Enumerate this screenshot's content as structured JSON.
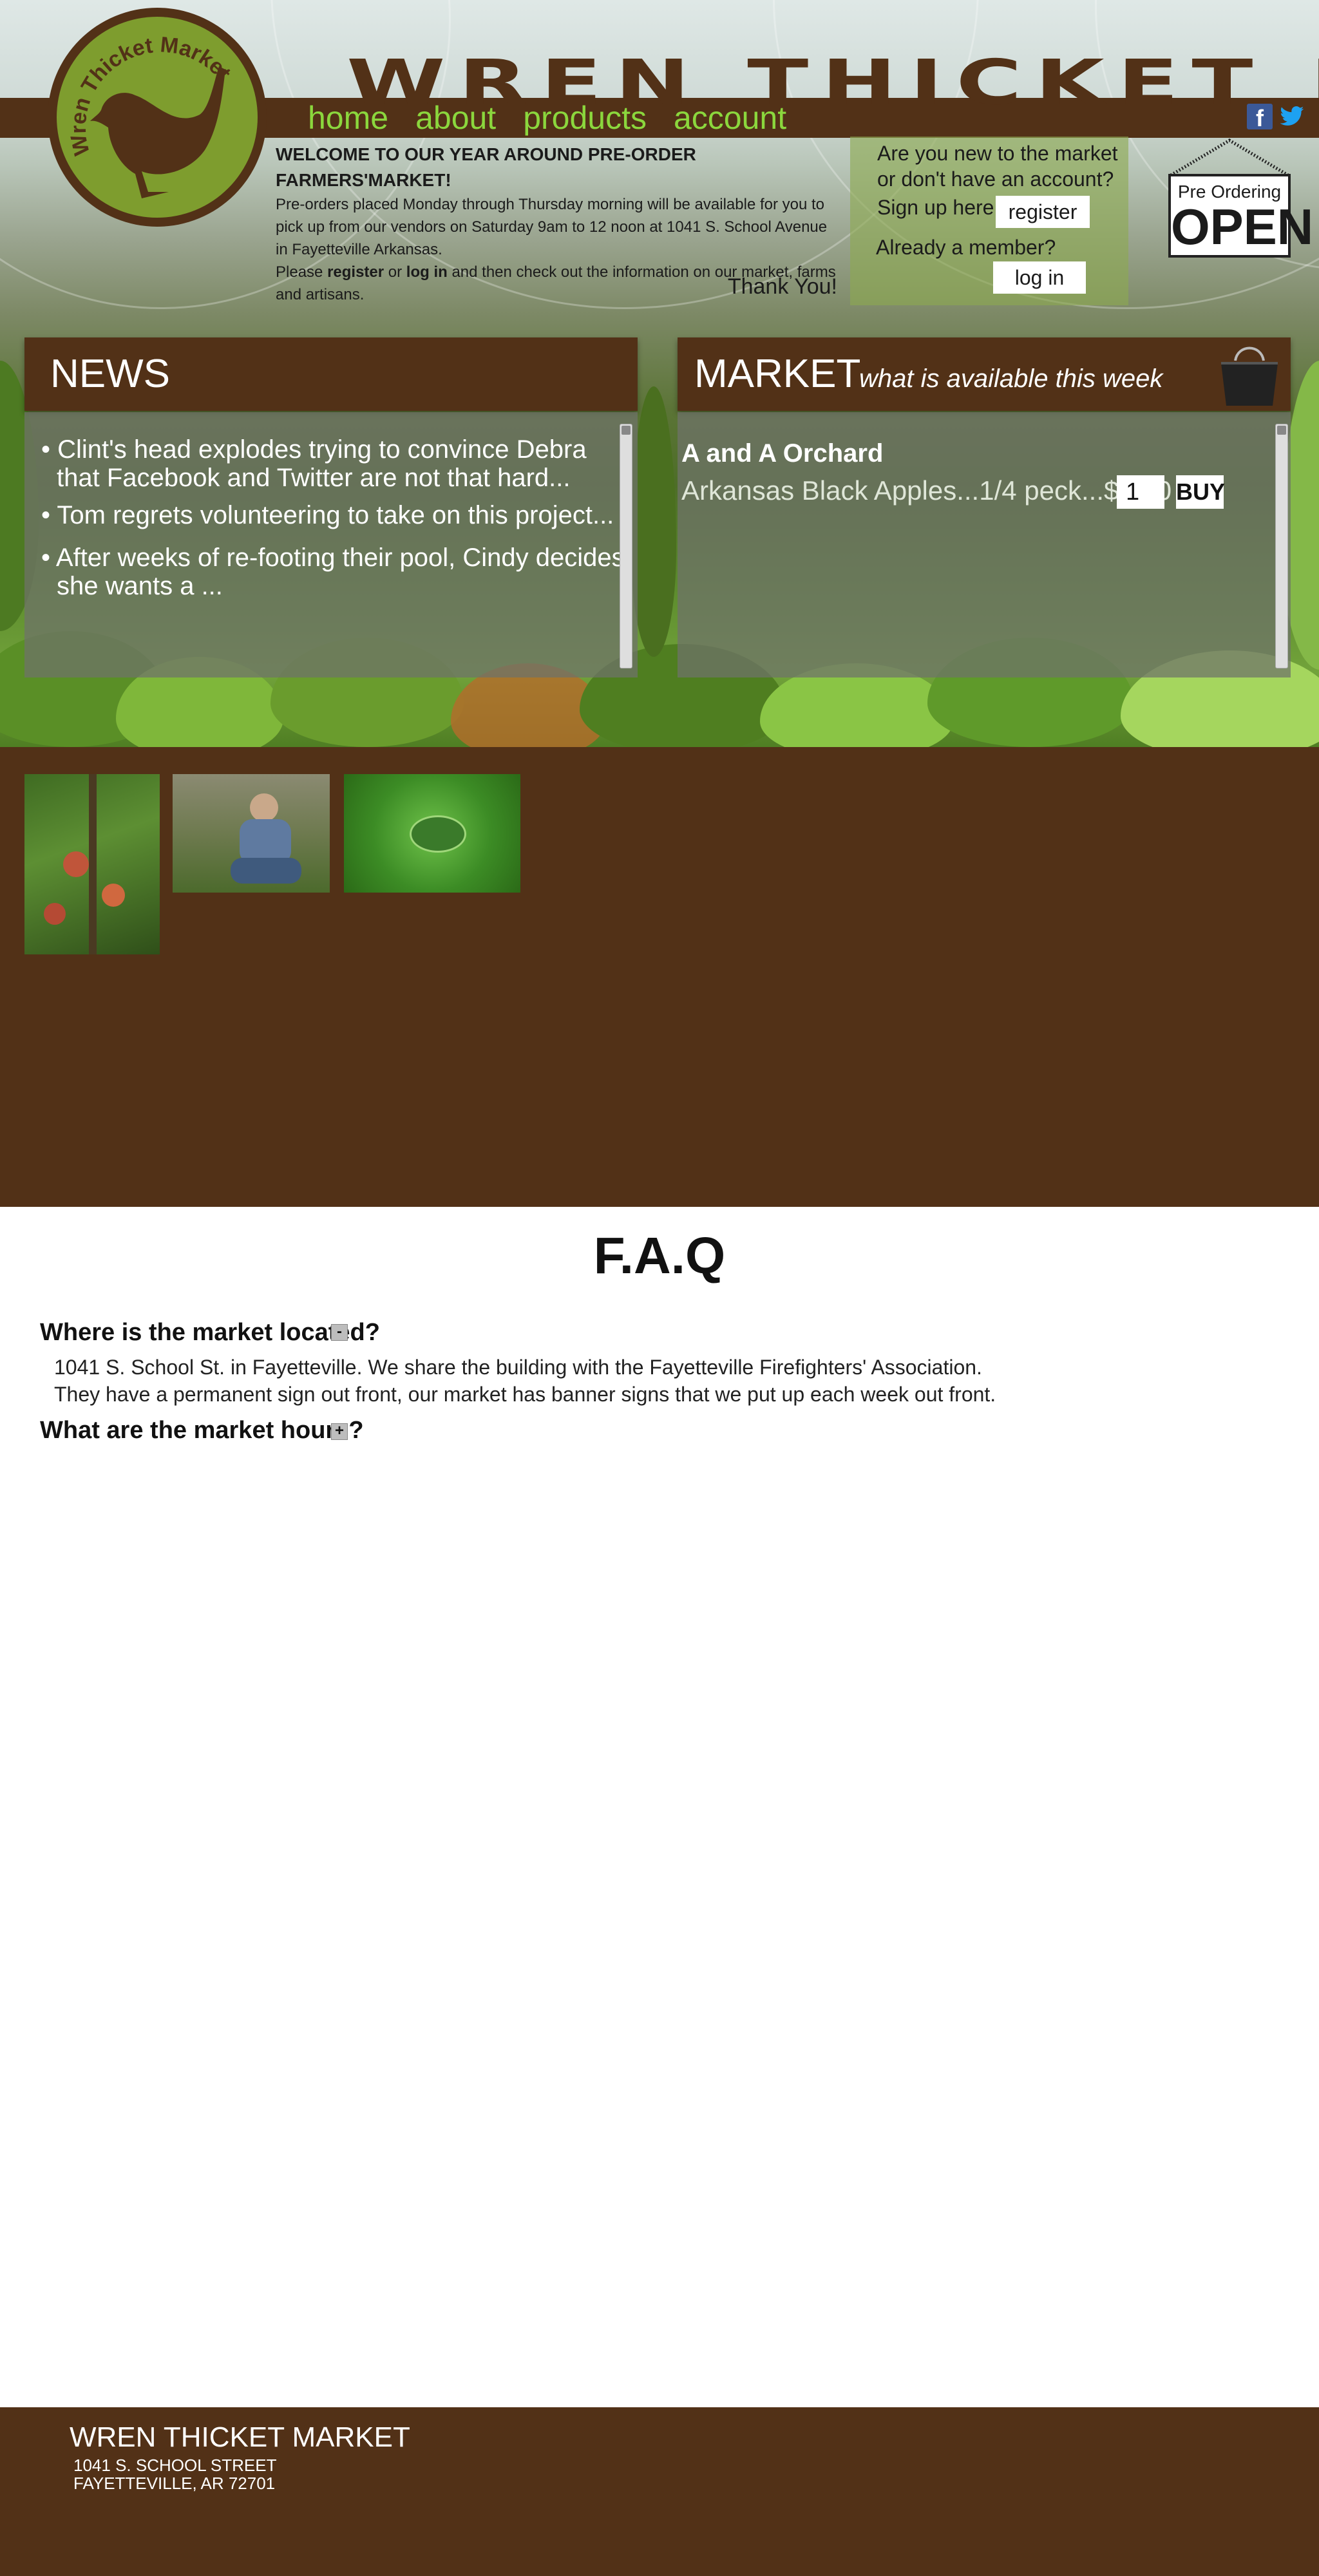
{
  "header": {
    "site_title": "WREN THICKET MARKET",
    "logo_text": "Wren Thicket Market",
    "nav": [
      "home",
      "about",
      "products",
      "account"
    ]
  },
  "social": {
    "facebook_glyph": "f",
    "icons": [
      "facebook-icon",
      "twitter-icon"
    ]
  },
  "welcome": {
    "heading": "WELCOME TO OUR YEAR AROUND PRE-ORDER FARMERS'MARKET!",
    "line1": "Pre-orders placed Monday through Thursday morning will be available for you to",
    "line2": "pick up from our vendors on Saturday  9am to 12 noon at 1041 S. School Avenue",
    "line3": "in Fayetteville Arkansas.",
    "line4_a": "Please ",
    "line4_register": "register",
    "line4_b": " or ",
    "line4_login": "log in",
    "line4_c": " and then check out the information on our market, farms",
    "line5": "and artisans.",
    "thanks": "Thank You!"
  },
  "signup": {
    "q1": "Are you new to the market",
    "q2": "or don't have an account?",
    "q3": "Sign up here!",
    "register_label": "register",
    "member": "Already a member?",
    "login_label": "log in"
  },
  "preorder_sign": {
    "line1": "Pre Ordering",
    "line2": "OPEN"
  },
  "news": {
    "title": "NEWS",
    "items": [
      [
        "Clint's head explodes trying to convince Debra",
        "that Facebook and Twitter are not that hard..."
      ],
      [
        "Tom regrets volunteering to take on this project..."
      ],
      [
        "After weeks of re-footing their pool, Cindy decides",
        "she wants a  ..."
      ]
    ],
    "bullet": "•"
  },
  "market": {
    "title": "MARKET",
    "subtitle": "what is available this week",
    "vendor": "A and A Orchard",
    "product": "Arkansas Black Apples...1/4 peck...$6.00",
    "quantity": "1",
    "buy_label": "BUY"
  },
  "faq": {
    "title": "F.A.Q",
    "q1": "Where is the market located?",
    "q1_toggle": "-",
    "a1_line1": "1041 S. School St. in Fayetteville. We share the building with the Fayetteville Firefighters' Association.",
    "a1_line2": "They have a permanent sign out front, our market has banner signs that we put up each week out front.",
    "q2": "What are the market hours?",
    "q2_toggle": "+"
  },
  "footer": {
    "name": "WREN THICKET MARKET",
    "addr1": "1041 S. SCHOOL STREET",
    "addr2": "FAYETTEVILLE, AR 72701"
  },
  "colors": {
    "brown": "#523117",
    "nav_green": "#8bd73d",
    "logo_green": "#7e9d2e",
    "white": "#ffffff"
  }
}
